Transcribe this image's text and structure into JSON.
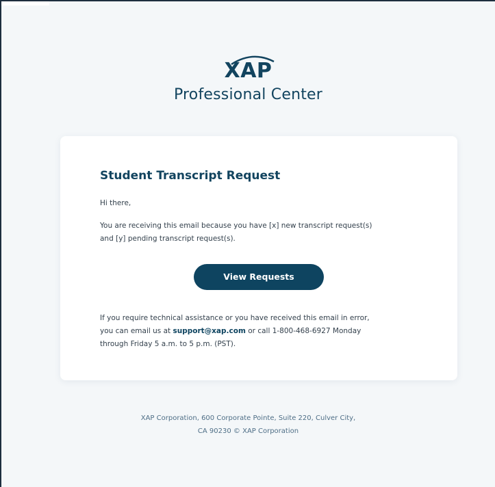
{
  "header": {
    "logo_text": "XAP",
    "subtitle": "Professional Center"
  },
  "card": {
    "title": "Student Transcript Request",
    "greeting": "Hi there,",
    "message_line1": "You are receiving this email because you have [x] new transcript request(s)",
    "message_line2": "and [y] pending transcript request(s).",
    "button_label": "View Requests",
    "help_line1": "If you require technical assistance or you have received this email in error,",
    "help_line2_prefix": "you can email us at ",
    "help_email": "support@xap.com",
    "help_line2_suffix": " or call 1-800-468-6927 Monday",
    "help_line3": "through Friday 5 a.m. to 5 p.m. (PST)."
  },
  "footer": {
    "line1": "XAP Corporation, 600 Corporate Pointe, Suite 220, Culver City,",
    "line2": "CA 90230 © XAP Corporation"
  },
  "colors": {
    "brand_navy": "#12445f",
    "button_bg": "#0e4460",
    "page_bg": "#f4f7f9",
    "card_bg": "#ffffff"
  }
}
